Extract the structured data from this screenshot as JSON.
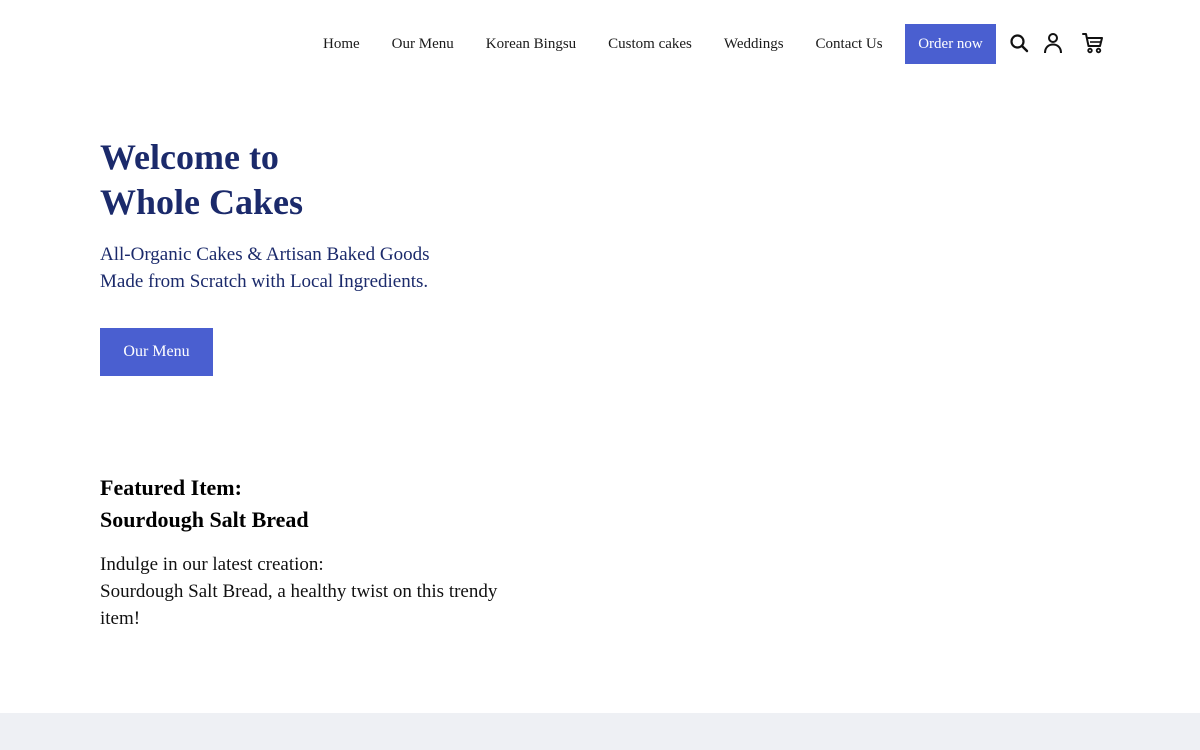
{
  "nav": {
    "items": [
      {
        "label": "Home"
      },
      {
        "label": "Our Menu"
      },
      {
        "label": "Korean Bingsu"
      },
      {
        "label": "Custom cakes"
      },
      {
        "label": "Weddings"
      },
      {
        "label": "Contact Us"
      }
    ],
    "order_label": "Order now",
    "icons": [
      "search-icon",
      "account-icon",
      "cart-icon"
    ]
  },
  "hero": {
    "title_line1": "Welcome to",
    "title_line2": "Whole Cakes",
    "subtitle_line1": "All-Organic Cakes & Artisan Baked Goods",
    "subtitle_line2": "Made from Scratch with Local Ingredients.",
    "button_label": "Our Menu"
  },
  "featured": {
    "heading_line1": "Featured Item:",
    "heading_line2": "Sourdough Salt Bread",
    "desc_line1": "Indulge in our latest creation:",
    "desc_line2": "Sourdough Salt Bread, a healthy twist on this trendy item!"
  },
  "colors": {
    "accent": "#4a5fd0",
    "heading": "#1b2a6b",
    "footer_band": "#eef0f4"
  }
}
